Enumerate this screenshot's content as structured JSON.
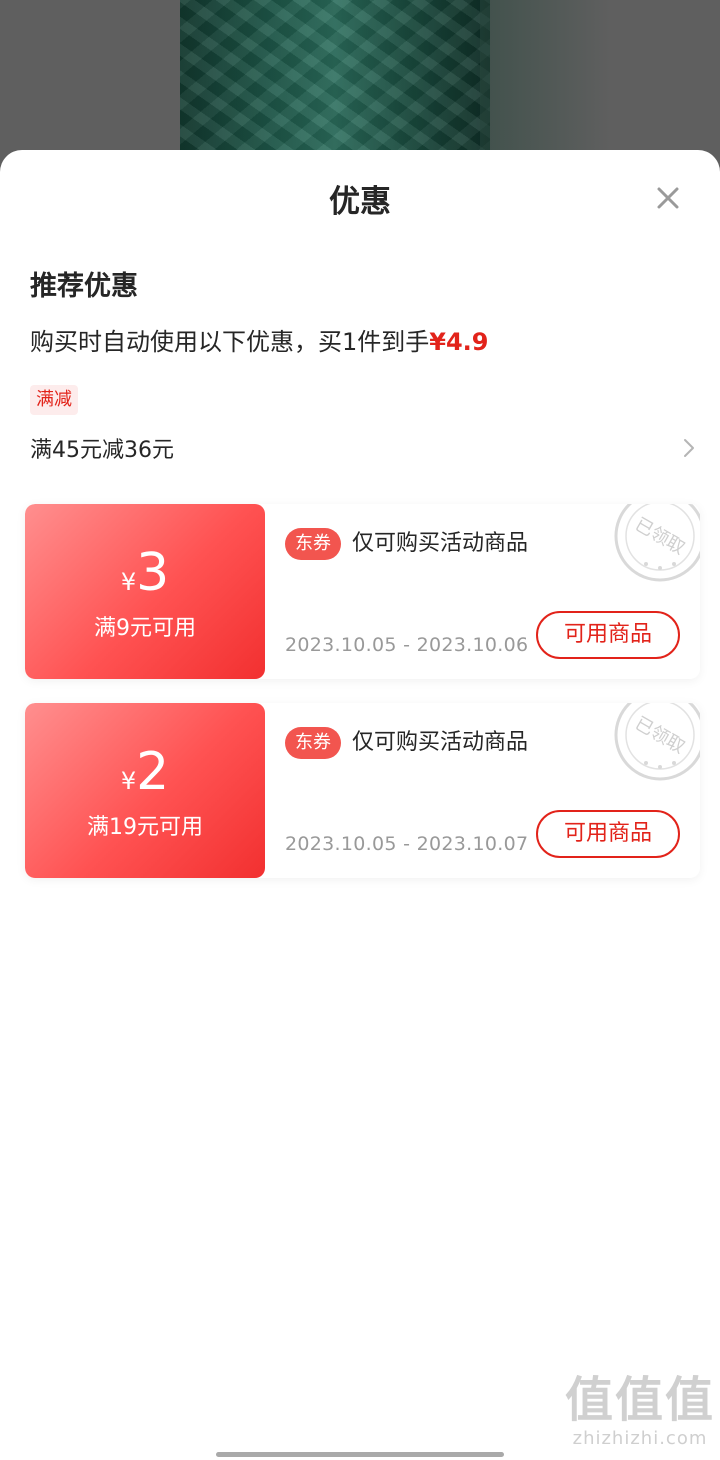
{
  "sheet": {
    "title": "优惠",
    "close_icon": "close-icon"
  },
  "recommend": {
    "title": "推荐优惠",
    "summary_prefix": "购买时自动使用以下优惠，买1件到手",
    "summary_price": "¥4.9",
    "tag": "满减",
    "rule": "满45元减36元",
    "rule_icon": "chevron-right-icon"
  },
  "coupons": [
    {
      "currency": "¥",
      "amount": "3",
      "condition": "满9元可用",
      "badge": "东券",
      "description": "仅可购买活动商品",
      "date_range": "2023.10.05 - 2023.10.06",
      "button": "可用商品",
      "stamp": "已领取"
    },
    {
      "currency": "¥",
      "amount": "2",
      "condition": "满19元可用",
      "badge": "东券",
      "description": "仅可购买活动商品",
      "date_range": "2023.10.05 - 2023.10.07",
      "button": "可用商品",
      "stamp": "已领取"
    }
  ],
  "watermark": {
    "logo": "值值值",
    "url": "zhizhizhi.com"
  },
  "colors": {
    "accent": "#e2231a",
    "coupon_gradient_start": "#ff8f8f",
    "coupon_gradient_end": "#f23030"
  }
}
